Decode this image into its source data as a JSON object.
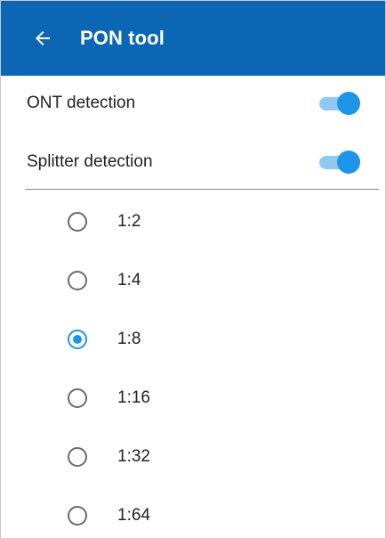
{
  "header": {
    "title": "PON tool",
    "back_icon": "arrow-left-icon",
    "background_color": "#0b66b4"
  },
  "settings": {
    "ont_detection": {
      "label": "ONT detection",
      "enabled": true
    },
    "splitter_detection": {
      "label": "Splitter detection",
      "enabled": true
    }
  },
  "splitter_ratios": {
    "options": [
      "1:2",
      "1:4",
      "1:8",
      "1:16",
      "1:32",
      "1:64"
    ],
    "selected": "1:8"
  },
  "colors": {
    "accent": "#1e95e9",
    "switch_track": "#8fc9f1"
  }
}
